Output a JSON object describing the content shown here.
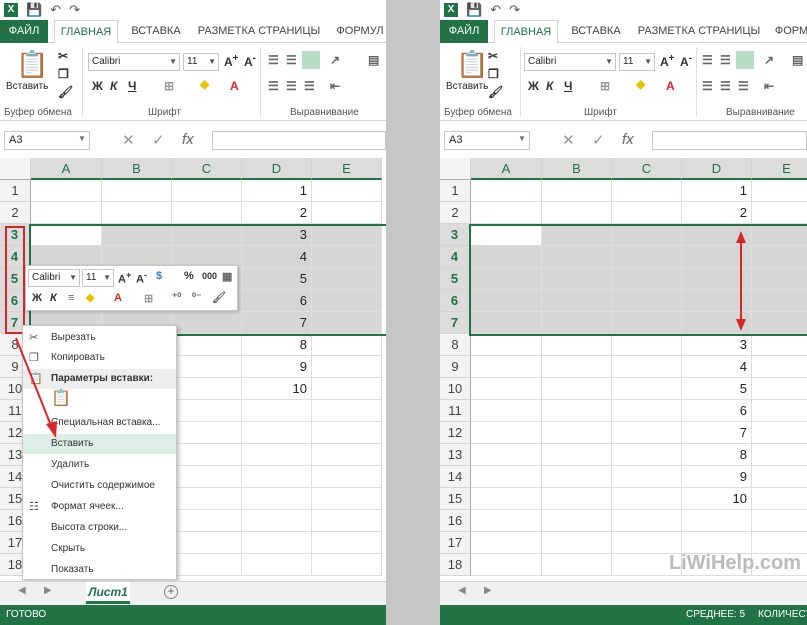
{
  "app": {
    "icon": "X"
  },
  "tabs": [
    "ФАЙЛ",
    "ГЛАВНАЯ",
    "ВСТАВКА",
    "РАЗМЕТКА СТРАНИЦЫ",
    "ФОРМУЛ"
  ],
  "tabs_right": [
    "ФАЙЛ",
    "ГЛАВНАЯ",
    "ВСТАВКА",
    "РАЗМЕТКА СТРАНИЦЫ",
    "ФОРМУ"
  ],
  "ribbon": {
    "paste_label": "Вставить",
    "clipboard_group": "Буфер обмена",
    "font_group": "Шрифт",
    "align_group": "Выравнивание",
    "font_name": "Calibri",
    "font_size": "11",
    "bold": "Ж",
    "italic": "К",
    "underline": "Ч"
  },
  "formula_bar": {
    "name_box": "A3",
    "fx": "fx"
  },
  "columns": [
    "A",
    "B",
    "C",
    "D",
    "E"
  ],
  "left": {
    "rows": [
      {
        "n": "1",
        "d": "1"
      },
      {
        "n": "2",
        "d": "2"
      },
      {
        "n": "3",
        "d": "3"
      },
      {
        "n": "4",
        "d": "4"
      },
      {
        "n": "5",
        "d": "5"
      },
      {
        "n": "6",
        "d": "6"
      },
      {
        "n": "7",
        "d": "7"
      },
      {
        "n": "8",
        "d": "8"
      },
      {
        "n": "9",
        "d": "9"
      },
      {
        "n": "10",
        "d": "10"
      },
      {
        "n": "11",
        "d": ""
      },
      {
        "n": "12",
        "d": ""
      },
      {
        "n": "13",
        "d": ""
      },
      {
        "n": "14",
        "d": ""
      },
      {
        "n": "15",
        "d": ""
      },
      {
        "n": "16",
        "d": ""
      },
      {
        "n": "17",
        "d": ""
      },
      {
        "n": "18",
        "d": ""
      }
    ]
  },
  "right": {
    "rows": [
      {
        "n": "1",
        "d": "1"
      },
      {
        "n": "2",
        "d": "2"
      },
      {
        "n": "3",
        "d": ""
      },
      {
        "n": "4",
        "d": ""
      },
      {
        "n": "5",
        "d": ""
      },
      {
        "n": "6",
        "d": ""
      },
      {
        "n": "7",
        "d": ""
      },
      {
        "n": "8",
        "d": "3"
      },
      {
        "n": "9",
        "d": "4"
      },
      {
        "n": "10",
        "d": "5"
      },
      {
        "n": "11",
        "d": "6"
      },
      {
        "n": "12",
        "d": "7"
      },
      {
        "n": "13",
        "d": "8"
      },
      {
        "n": "14",
        "d": "9"
      },
      {
        "n": "15",
        "d": "10"
      },
      {
        "n": "16",
        "d": ""
      },
      {
        "n": "17",
        "d": ""
      },
      {
        "n": "18",
        "d": ""
      }
    ]
  },
  "minibar": {
    "font": "Calibri",
    "size": "11",
    "bold": "Ж",
    "italic": "К",
    "percent": "%",
    "thousands": "000"
  },
  "context_menu": [
    {
      "label": "Вырезать",
      "icon": "scissors-icon",
      "glyph": "✂"
    },
    {
      "label": "Копировать",
      "icon": "copy-icon",
      "glyph": "❐"
    },
    {
      "label": "Параметры вставки:",
      "icon": "paste-options-icon",
      "glyph": "📋",
      "header": true
    },
    {
      "label": "",
      "icon": "clipboard-icon",
      "glyph": "📋"
    },
    {
      "label": "Специальная вставка...",
      "icon": "",
      "glyph": ""
    },
    {
      "label": "Вставить",
      "icon": "",
      "glyph": "",
      "highlight": true
    },
    {
      "label": "Удалить",
      "icon": "",
      "glyph": ""
    },
    {
      "label": "Очистить содержимое",
      "icon": "",
      "glyph": ""
    },
    {
      "label": "Формат ячеек...",
      "icon": "format-cells-icon",
      "glyph": "☷"
    },
    {
      "label": "Высота строки...",
      "icon": "",
      "glyph": ""
    },
    {
      "label": "Скрыть",
      "icon": "",
      "glyph": ""
    },
    {
      "label": "Показать",
      "icon": "",
      "glyph": ""
    }
  ],
  "sheet": {
    "name": "Лист1"
  },
  "status": {
    "left": "ГОТОВО",
    "right_avg": "СРЕДНЕЕ: 5",
    "right_count": "КОЛИЧЕСТ"
  },
  "watermark": "LiWiHelp.com",
  "colors": {
    "excel_green": "#217346",
    "arrow_red": "#d9262b"
  }
}
